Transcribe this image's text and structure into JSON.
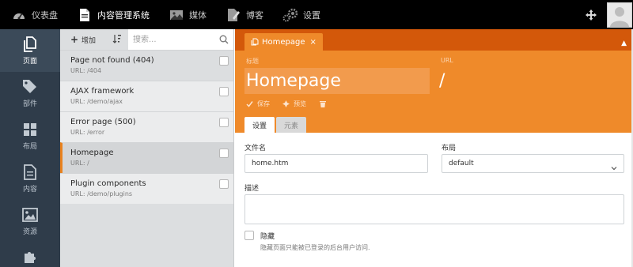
{
  "topnav": {
    "items": [
      {
        "label": "仪表盘",
        "icon": "dashboard-icon",
        "active": false
      },
      {
        "label": "内容管理系统",
        "icon": "cms-icon",
        "active": true
      },
      {
        "label": "媒体",
        "icon": "media-icon",
        "active": false
      },
      {
        "label": "博客",
        "icon": "blog-icon",
        "active": false
      },
      {
        "label": "设置",
        "icon": "settings-icon",
        "active": false
      }
    ]
  },
  "sidebar": {
    "items": [
      {
        "label": "页面",
        "icon": "pages-icon",
        "active": true
      },
      {
        "label": "部件",
        "icon": "tag-icon",
        "active": false
      },
      {
        "label": "布局",
        "icon": "layout-icon",
        "active": false
      },
      {
        "label": "内容",
        "icon": "content-icon",
        "active": false
      },
      {
        "label": "资源",
        "icon": "assets-icon",
        "active": false
      }
    ]
  },
  "list": {
    "add_label": "增加",
    "search_placeholder": "搜索...",
    "pages": [
      {
        "title": "Page not found (404)",
        "url": "URL: /404"
      },
      {
        "title": "AJAX framework",
        "url": "URL: /demo/ajax"
      },
      {
        "title": "Error page (500)",
        "url": "URL: /error"
      },
      {
        "title": "Homepage",
        "url": "URL: /"
      },
      {
        "title": "Plugin components",
        "url": "URL: /demo/plugins"
      }
    ]
  },
  "editor": {
    "tab_label": "Homepage",
    "tab_close": "×",
    "title_label": "标题",
    "title_value": "Homepage",
    "url_label": "URL",
    "url_value": "/",
    "actions": {
      "save": "保存",
      "preview": "预览"
    },
    "subtabs": {
      "settings": "设置",
      "elements": "元素"
    },
    "form": {
      "filename_label": "文件名",
      "filename_value": "home.htm",
      "layout_label": "布局",
      "layout_value": "default",
      "description_label": "描述",
      "hidden_label": "隐藏",
      "hidden_help": "隐藏页面只能被已登录的后台用户访问."
    }
  },
  "colors": {
    "accent": "#ef8a2a",
    "accent_dark": "#d3580a",
    "sidebar": "#2f3c4a",
    "topbar": "#000000"
  }
}
